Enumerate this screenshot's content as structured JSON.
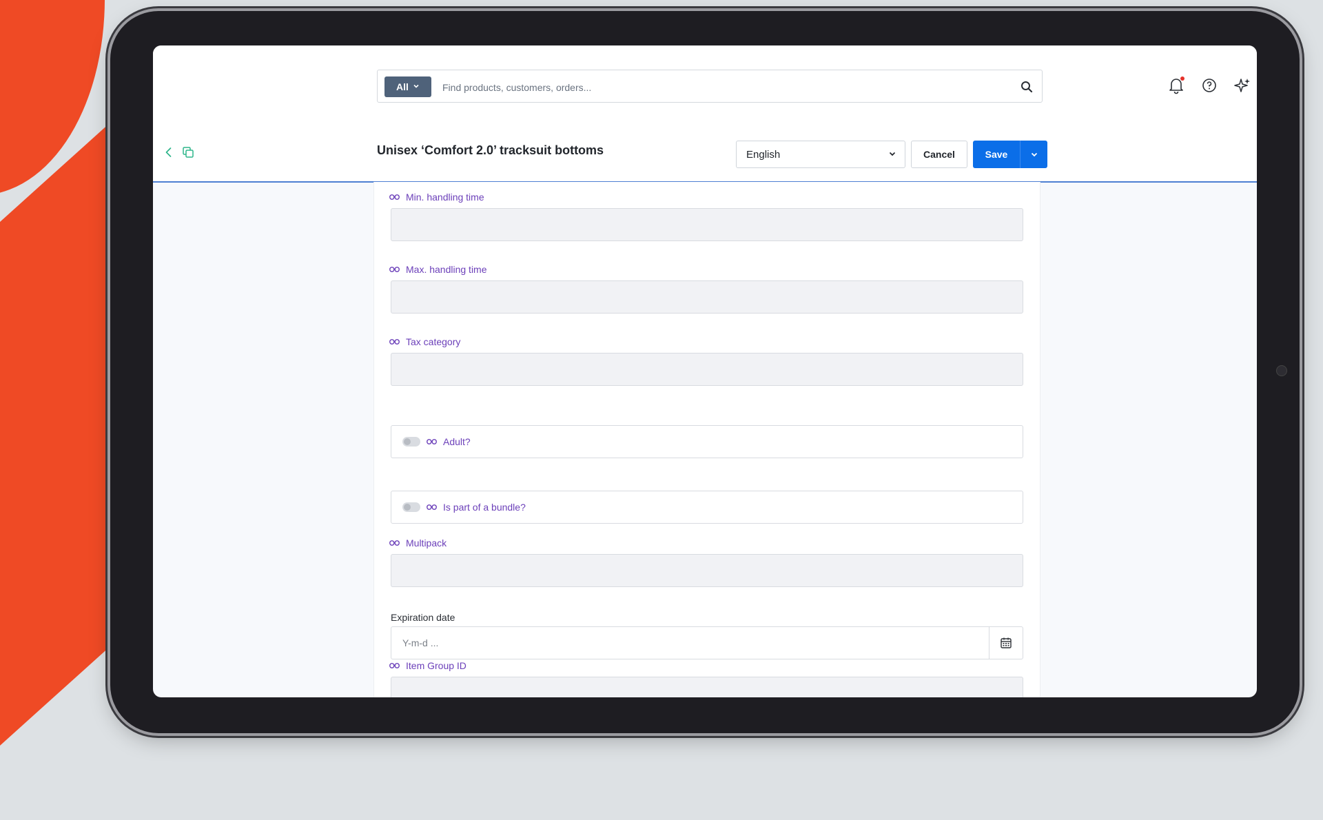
{
  "search": {
    "scope_label": "All",
    "placeholder": "Find products, customers, orders..."
  },
  "header": {
    "title": "Unisex ‘Comfort 2.0’ tracksuit bottoms",
    "language": "English",
    "cancel_label": "Cancel",
    "save_label": "Save"
  },
  "fields": {
    "min_handling_time": "Min. handling time",
    "max_handling_time": "Max. handling time",
    "tax_category": "Tax category",
    "adult": "Adult?",
    "is_bundle": "Is part of a bundle?",
    "multipack": "Multipack",
    "expiration_date": "Expiration date",
    "expiration_placeholder": "Y-m-d ...",
    "item_group_id": "Item Group ID"
  },
  "colors": {
    "accent_orange": "#ef4a25",
    "primary_blue": "#0b6ee8",
    "inherited_label_purple": "#6b3fb9",
    "notification_dot": "#e5312a"
  }
}
